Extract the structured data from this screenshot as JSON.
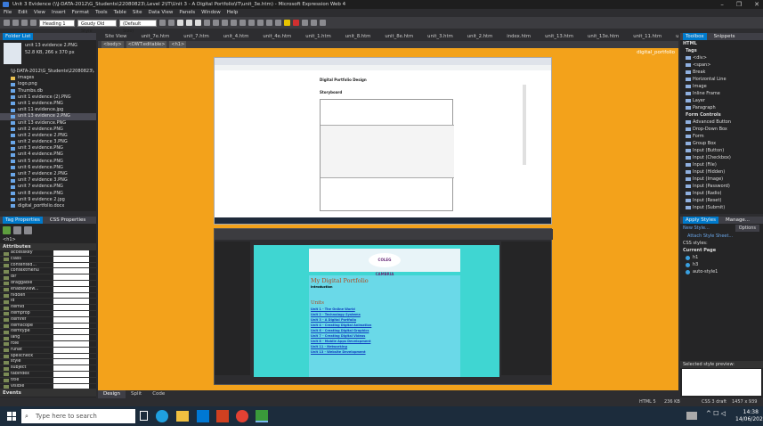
{
  "window": {
    "title": "Unit 3 Evidence (\\\\J-DATA-2012\\G_Students\\22080823\\.Level 2\\IT\\Unit 3 - A Digital Portfolio\\IT\\unit_3e.htm) - Microsoft Expression Web 4",
    "controls": [
      "–",
      "❐",
      "✕"
    ]
  },
  "menu": [
    "File",
    "Edit",
    "View",
    "Insert",
    "Format",
    "Tools",
    "Table",
    "Site",
    "Data View",
    "Panels",
    "Window",
    "Help"
  ],
  "toolbar": {
    "style_select": "Heading 1",
    "font_select": "Goudy Old Style",
    "size_select": "(Default Size)"
  },
  "folder_list": {
    "title": "Folder List",
    "preview_name": "unit 13 evidence 2.PNG",
    "preview_info": "52.8 KB, 266 x 370 px",
    "root": "\\\\J-DATA-2012\\G_Students\\22080823\\.",
    "items": [
      {
        "name": "images",
        "type": "folder"
      },
      {
        "name": "logo.png",
        "type": "file"
      },
      {
        "name": "Thumbs.db",
        "type": "file"
      },
      {
        "name": "unit 1 evidence (2).PNG",
        "type": "file"
      },
      {
        "name": "unit 1 evidence.PNG",
        "type": "file"
      },
      {
        "name": "unit 11 evidence.jpg",
        "type": "file"
      },
      {
        "name": "unit 13 evidence 2.PNG",
        "type": "file",
        "selected": true
      },
      {
        "name": "unit 13 evidence.PNG",
        "type": "file"
      },
      {
        "name": "unit 2 evidence.PNG",
        "type": "file"
      },
      {
        "name": "unit 2 evidence 2.PNG",
        "type": "file"
      },
      {
        "name": "unit 2 evidence 3.PNG",
        "type": "file"
      },
      {
        "name": "unit 3 evidence.PNG",
        "type": "file"
      },
      {
        "name": "unit 4 evidence.PNG",
        "type": "file"
      },
      {
        "name": "unit 5 evidence.PNG",
        "type": "file"
      },
      {
        "name": "unit 6 evidence.PNG",
        "type": "file"
      },
      {
        "name": "unit 7 evidence 2.PNG",
        "type": "file"
      },
      {
        "name": "unit 7 evidence 3.PNG",
        "type": "file"
      },
      {
        "name": "unit 7 evidence.PNG",
        "type": "file"
      },
      {
        "name": "unit 8 evidence.PNG",
        "type": "file"
      },
      {
        "name": "unit 9 evidence 2.jpg",
        "type": "file"
      },
      {
        "name": "digital_portfolio.docx",
        "type": "file"
      }
    ]
  },
  "tag_properties": {
    "tab1": "Tag Properties",
    "tab2": "CSS Properties",
    "element": "<h1>",
    "section": "Attributes",
    "attributes": [
      "accesskey",
      "class",
      "contented...",
      "contextmenu",
      "dir",
      "draggable",
      "enableview...",
      "hidden",
      "id",
      "itemid",
      "itemprop",
      "itemref",
      "itemscope",
      "itemtype",
      "lang",
      "role",
      "runat",
      "spellcheck",
      "style",
      "subject",
      "tabindex",
      "title",
      "visible"
    ],
    "events": "Events"
  },
  "doc_tabs": [
    "Site View",
    "unit_7e.htm",
    "unit_7.htm",
    "unit_4.htm",
    "unit_4e.htm",
    "unit_1.htm",
    "unit_8.htm",
    "unit_8e.htm",
    "unit_3.htm",
    "unit_2.htm",
    "index.htm",
    "unit_13.htm",
    "unit_13e.htm",
    "unit_11.htm",
    "unit_11e.htm",
    "unit_3e.htm"
  ],
  "active_doc_tab": "unit_3e.htm",
  "tag_selector": [
    "<body>",
    "<DWT:editable>",
    "<h1>"
  ],
  "design_view": {
    "label": "digital_portfolio",
    "shot1_heading": "Digital Portfolio Design",
    "shot1_sub": "Storyboard",
    "shot2_banner": "COLEG CAMBRIA",
    "shot2_heading": "My Digital Portfolio",
    "shot2_intro": "Introduction",
    "shot2_units_title": "Units",
    "shot2_units": [
      "Unit 1 - The Online World",
      "Unit 2 - Technology Systems",
      "Unit 3 - A Digital Portfolio",
      "Unit 4 - Creating Digital Animation",
      "Unit 6 - Creating Digital Graphics",
      "Unit 7 - Creating Digital Videos",
      "Unit 8 - Mobile Apps Development",
      "Unit 11 - Networking",
      "Unit 13 - Website Development"
    ]
  },
  "view_tabs": [
    "Design",
    "Split",
    "Code"
  ],
  "active_view": "Design",
  "toolbox": {
    "tab1": "Toolbox",
    "tab2": "Snippets",
    "html_section": "HTML",
    "tags_section": "Tags",
    "tags": [
      "<div>",
      "<span>",
      "Break",
      "Horizontal Line",
      "Image",
      "Inline Frame",
      "Layer",
      "Paragraph"
    ],
    "form_section": "Form Controls",
    "forms": [
      "Advanced Button",
      "Drop-Down Box",
      "Form",
      "Group Box",
      "Input (Button)",
      "Input (Checkbox)",
      "Input (File)",
      "Input (Hidden)",
      "Input (Image)",
      "Input (Password)",
      "Input (Radio)",
      "Input (Reset)",
      "Input (Submit)"
    ]
  },
  "apply_styles": {
    "tab1": "Apply Styles",
    "tab2": "Manage...",
    "new_style": "New Style...",
    "options": "Options",
    "attach": "Attach Style Sheet...",
    "css_styles_label": "CSS styles:",
    "current_page": "Current Page",
    "styles": [
      "h1",
      "h3",
      "auto-style1"
    ],
    "preview_label": "Selected style preview:"
  },
  "statusbar": {
    "html": "HTML 5",
    "size": "236 KB",
    "css": "CSS 3 draft",
    "dims": "1457 x 939"
  },
  "taskbar": {
    "search_placeholder": "Type here to search",
    "time": "14:38",
    "date": "14/06/2023"
  }
}
